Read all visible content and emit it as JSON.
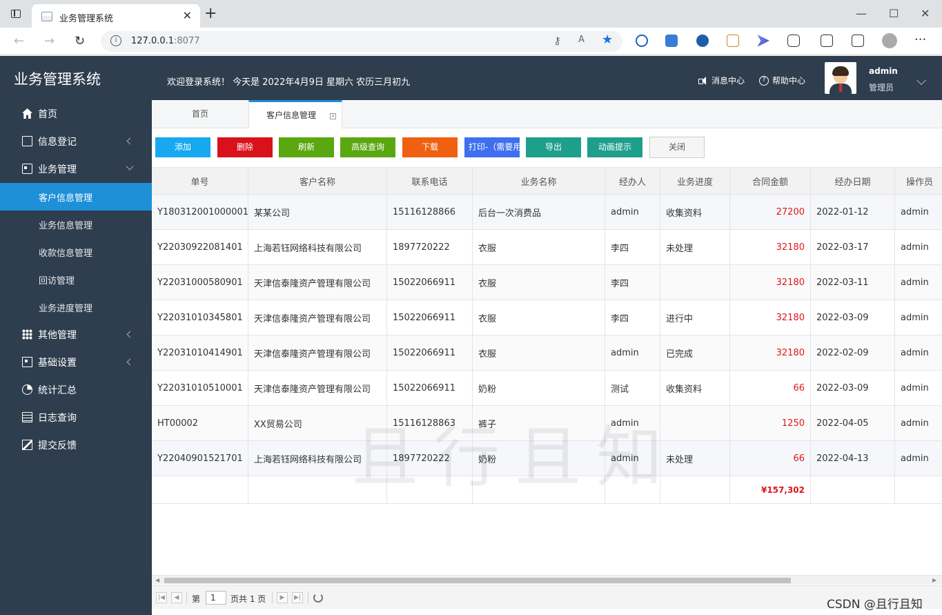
{
  "browser": {
    "tab_title": "业务管理系统",
    "url_host": "127.0.0.1",
    "url_port": ":8077"
  },
  "header": {
    "title": "业务管理系统",
    "welcome": "欢迎登录系统！ 今天是 2022年4月9日 星期六 农历三月初九",
    "message_center": "消息中心",
    "help_center": "帮助中心",
    "user_name": "admin",
    "user_role": "管理员"
  },
  "sidebar": {
    "items": [
      {
        "label": "首页",
        "icon": "home-icon"
      },
      {
        "label": "信息登记",
        "icon": "edit-icon"
      },
      {
        "label": "业务管理",
        "icon": "card-icon"
      },
      {
        "label": "客户信息管理"
      },
      {
        "label": "业务信息管理"
      },
      {
        "label": "收款信息管理"
      },
      {
        "label": "回访管理"
      },
      {
        "label": "业务进度管理"
      },
      {
        "label": "其他管理",
        "icon": "grid-icon"
      },
      {
        "label": "基础设置",
        "icon": "qr-icon"
      },
      {
        "label": "统计汇总",
        "icon": "pie-icon"
      },
      {
        "label": "日志查询",
        "icon": "log-icon"
      },
      {
        "label": "提交反馈",
        "icon": "feedback-icon"
      }
    ]
  },
  "tabs": [
    {
      "label": "首页"
    },
    {
      "label": "客户信息管理"
    }
  ],
  "toolbar": {
    "buttons": [
      {
        "label": "添加",
        "color": "#16a9ef"
      },
      {
        "label": "删除",
        "color": "#d8111a"
      },
      {
        "label": "刷新",
        "color": "#5aa70f"
      },
      {
        "label": "高级查询",
        "color": "#5aa70f"
      },
      {
        "label": "下载",
        "color": "#f06010"
      },
      {
        "label": "打印-（需要用",
        "color": "#3f6ff0"
      },
      {
        "label": "导出",
        "color": "#1e9f8c"
      },
      {
        "label": "动画提示",
        "color": "#1e9f8c"
      },
      {
        "label": "关闭",
        "color": "#f5f5f5"
      }
    ]
  },
  "table": {
    "columns": [
      "单号",
      "客户名称",
      "联系电话",
      "业务名称",
      "经办人",
      "业务进度",
      "合同金额",
      "经办日期",
      "操作员"
    ],
    "rows": [
      [
        "Y180312001000001",
        "某某公司",
        "15116128866",
        "后台一次消费品",
        "admin",
        "收集资料",
        "27200",
        "2022-01-12",
        "admin"
      ],
      [
        "Y22030922081401",
        "上海若钰网络科技有限公司",
        "1897720222",
        "衣服",
        "李四",
        "未处理",
        "32180",
        "2022-03-17",
        "admin"
      ],
      [
        "Y22031000580901",
        "天津信泰隆资产管理有限公司",
        "15022066911",
        "衣服",
        "李四",
        "",
        "32180",
        "2022-03-11",
        "admin"
      ],
      [
        "Y22031010345801",
        "天津信泰隆资产管理有限公司",
        "15022066911",
        "衣服",
        "李四",
        "进行中",
        "32180",
        "2022-03-09",
        "admin"
      ],
      [
        "Y22031010414901",
        "天津信泰隆资产管理有限公司",
        "15022066911",
        "衣服",
        "admin",
        "已完成",
        "32180",
        "2022-02-09",
        "admin"
      ],
      [
        "Y22031010510001",
        "天津信泰隆资产管理有限公司",
        "15022066911",
        "奶粉",
        "测试",
        "收集资料",
        "66",
        "2022-03-09",
        "admin"
      ],
      [
        "HT00002",
        "XX贸易公司",
        "15116128863",
        "裤子",
        "admin",
        "",
        "1250",
        "2022-04-05",
        "admin"
      ],
      [
        "Y22040901521701",
        "上海若钰网络科技有限公司",
        "1897720222",
        "奶粉",
        "admin",
        "未处理",
        "66",
        "2022-04-13",
        "admin"
      ]
    ],
    "total": "¥157,302"
  },
  "pager": {
    "page_prefix": "第",
    "page_value": "1",
    "page_suffix": "页共 1 页"
  },
  "watermark": "且行且知",
  "csdn": "CSDN @且行且知"
}
